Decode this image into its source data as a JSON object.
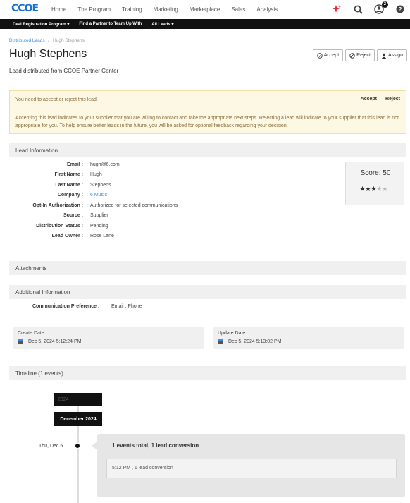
{
  "brand": {
    "logo_text": "CCOE",
    "accent": "#1a73c8"
  },
  "nav": {
    "links": [
      "Home",
      "The Program",
      "Training",
      "Marketing",
      "Marketplace",
      "Sales",
      "Analysis"
    ],
    "notification_count": "2"
  },
  "subnav": [
    "Deal Registration Program ▾",
    "Find a Partner to Team Up With",
    "All Leads ▾"
  ],
  "breadcrumb": {
    "parent": "Distributed Leads",
    "separator": "/",
    "current": "Hugh Stephens"
  },
  "header": {
    "title": "Hugh Stephens",
    "subtitle": "Lead distributed from CCOE Partner Center",
    "accept_label": "Accept",
    "reject_label": "Reject",
    "assign_label": "Assign"
  },
  "alert": {
    "message": "You need to accept or reject this lead.",
    "accept_label": "Accept",
    "reject_label": "Reject",
    "body": "Accepting this lead indicates to your supplier that you are willing to contact and take the appropriate next steps. Rejecting a lead will indicate to your supplier that this lead is not appropriate for you. To help ensure better leads in the future, you will be asked for optional feedback regarding your decision."
  },
  "lead_info": {
    "title": "Lead Information",
    "fields": [
      {
        "label": "Email :",
        "value": "hugh@6.com"
      },
      {
        "label": "First Name :",
        "value": "Hugh"
      },
      {
        "label": "Last Name :",
        "value": "Stephens"
      },
      {
        "label": "Company :",
        "value": "6 Music"
      },
      {
        "label": "Opt-In Authorization :",
        "value": "Authorized for selected communications"
      },
      {
        "label": "Source :",
        "value": "Supplier"
      },
      {
        "label": "Distribution Status :",
        "value": "Pending"
      },
      {
        "label": "Lead Owner :",
        "value": "Rose Lane"
      }
    ],
    "score_text": "Score: 50",
    "stars_filled": 3,
    "stars_total": 5
  },
  "attachments": {
    "title": "Attachments"
  },
  "additional": {
    "title": "Additional Information",
    "pref_label": "Communication Preference :",
    "pref_value": "Email , Phone",
    "create_title": "Create Date",
    "create_value": "Dec 5, 2024 5:12:24 PM",
    "update_title": "Update Date",
    "update_value": "Dec 5, 2024 5:13:02 PM"
  },
  "timeline": {
    "title": "Timeline (1 events)",
    "year": "2024",
    "month": "December 2024",
    "date": "Thu, Dec 5",
    "summary": "1 events total, 1 lead conversion",
    "entry": "5:12 PM , 1 lead conversion"
  }
}
